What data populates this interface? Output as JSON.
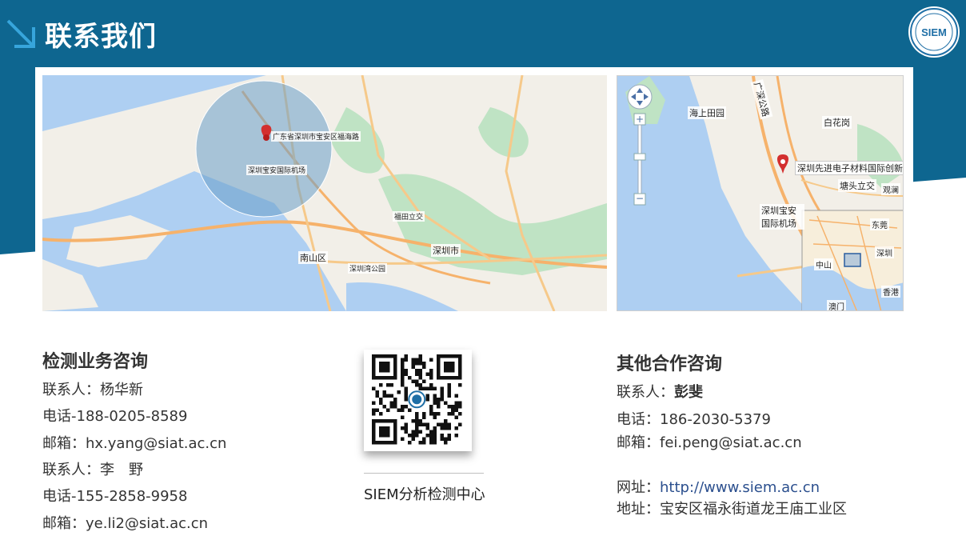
{
  "header": {
    "title": "联系我们",
    "logo_text": "SIEM"
  },
  "maps": {
    "left_marker_label": "广东省深圳市宝安区福海路",
    "right_marker_label": "深圳先进电子材料国际创新",
    "right_labels": [
      "海上田园",
      "广深公路",
      "白花岗",
      "塘头立交",
      "深圳宝安国际机场",
      "东莞",
      "深圳",
      "中山",
      "香港",
      "澳门",
      "观澜"
    ],
    "left_labels": [
      "深圳市",
      "南山区",
      "深圳宝安国际机场",
      "福田立交",
      "深圳湾公园"
    ]
  },
  "testing": {
    "title": "检测业务咨询",
    "contacts": [
      {
        "name_line": "联系人：杨华新",
        "phone_line": "电话-188-0205-8589",
        "email_line": "邮箱：hx.yang@siat.ac.cn"
      },
      {
        "name_line": "联系人：李　野",
        "phone_line": "电话-155-2858-9958",
        "email_line": "邮箱：ye.li2@siat.ac.cn"
      }
    ]
  },
  "qr": {
    "caption": "SIEM分析检测中心"
  },
  "other": {
    "title": "其他合作咨询",
    "name_prefix": "联系人：",
    "name": "彭斐",
    "phone_line": "电话：186-2030-5379",
    "email_line": "邮箱：fei.peng@siat.ac.cn",
    "website_prefix": "网址：",
    "website": "http://www.siem.ac.cn",
    "address_line": "地址：宝安区福永街道龙王庙工业区"
  },
  "colors": {
    "banner": "#0e6690",
    "accent": "#2a8ec9",
    "map_water": "#aecff2",
    "map_land": "#f2efe8",
    "map_green": "#bfe3c4",
    "link": "#2b4f8e"
  }
}
